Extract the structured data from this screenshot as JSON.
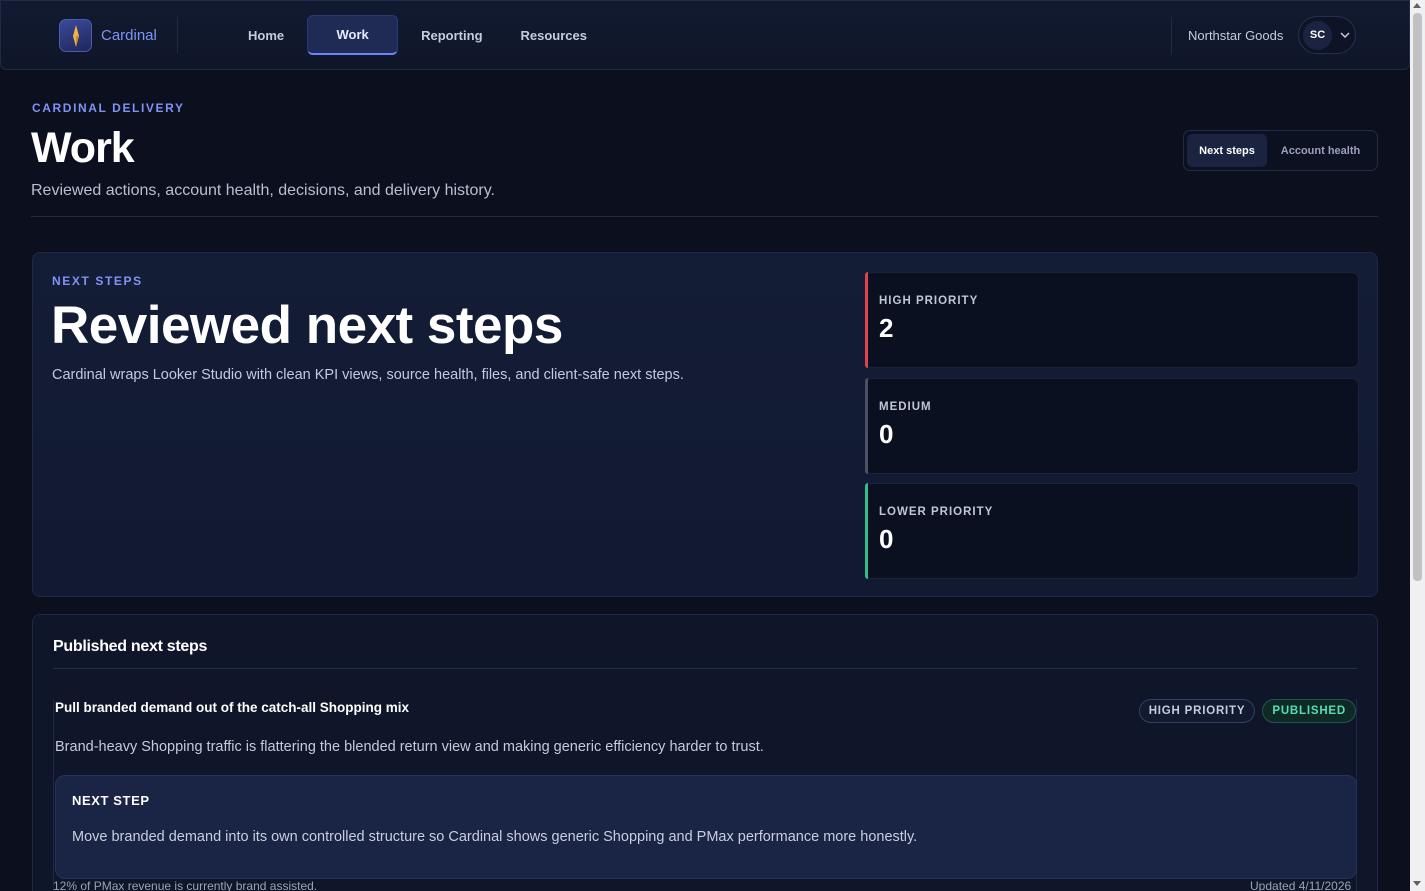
{
  "app": {
    "brand": "Cardinal",
    "org": "Northstar Goods",
    "avatar": "SC"
  },
  "nav": {
    "items": [
      {
        "label": "Home",
        "active": false
      },
      {
        "label": "Work",
        "active": true
      },
      {
        "label": "Reporting",
        "active": false
      },
      {
        "label": "Resources",
        "active": false
      }
    ]
  },
  "header": {
    "eyebrow": "CARDINAL DELIVERY",
    "title": "Work",
    "subtitle": "Reviewed actions, account health, decisions, and delivery history.",
    "segments": [
      {
        "label": "Next steps",
        "active": true
      },
      {
        "label": "Account health",
        "active": false
      }
    ]
  },
  "hero": {
    "eyebrow": "NEXT STEPS",
    "title": "Reviewed next steps",
    "description": "Cardinal wraps Looker Studio with clean KPI views, source health, files, and client-safe next steps.",
    "stats": [
      {
        "label": "HIGH PRIORITY",
        "value": "2",
        "color": "#e0434b"
      },
      {
        "label": "MEDIUM",
        "value": "0",
        "color": "#4a5168"
      },
      {
        "label": "LOWER PRIORITY",
        "value": "0",
        "color": "#2fbf8a"
      }
    ]
  },
  "published": {
    "title": "Published next steps",
    "item": {
      "title": "Pull branded demand out of the catch-all Shopping mix",
      "badges": {
        "priority": "HIGH PRIORITY",
        "status": "PUBLISHED"
      },
      "description": "Brand-heavy Shopping traffic is flattering the blended return view and making generic efficiency harder to trust.",
      "next_step_label": "NEXT STEP",
      "next_step_text": "Move branded demand into its own controlled structure so Cardinal shows generic Shopping and PMax performance more honestly.",
      "footnote": "12% of PMax revenue is currently brand assisted.",
      "updated": "Updated 4/11/2026"
    }
  },
  "colors": {
    "accent": "#7f93f5",
    "background": "#0b0f1e",
    "published": "#52e0b0"
  }
}
